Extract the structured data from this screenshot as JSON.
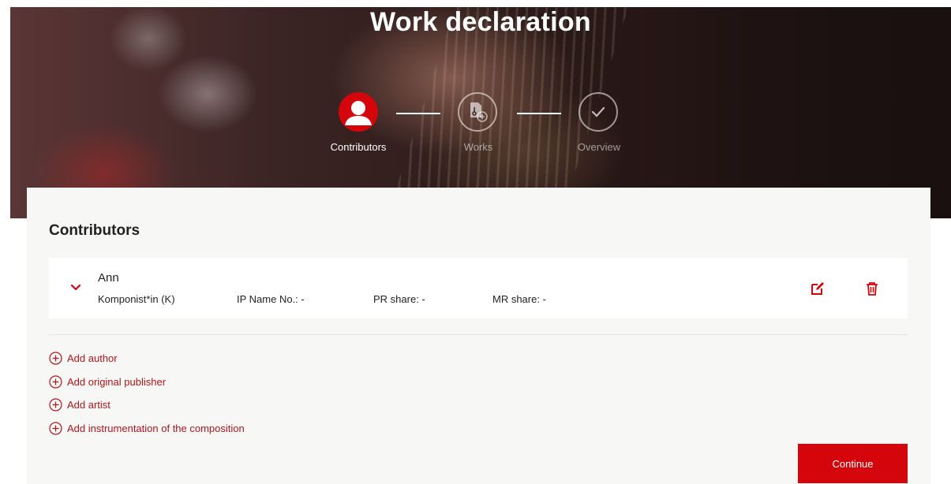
{
  "header": {
    "title": "Work declaration"
  },
  "stepper": {
    "steps": [
      {
        "label": "Contributors",
        "icon": "user-icon",
        "state": "active"
      },
      {
        "label": "Works",
        "icon": "document-add-icon",
        "state": "inactive"
      },
      {
        "label": "Overview",
        "icon": "checkmark-icon",
        "state": "inactive"
      }
    ]
  },
  "contributors": {
    "title": "Contributors",
    "items": [
      {
        "name": "Ann",
        "role": "Komponist*in (K)",
        "ip_name_no": "IP Name No.: -",
        "pr_share": "PR share: -",
        "mr_share": "MR share: -"
      }
    ]
  },
  "actions": {
    "add_author": "Add author",
    "add_original_publisher": "Add original publisher",
    "add_artist": "Add artist",
    "add_instrumentation": "Add instrumentation of the composition",
    "continue": "Continue"
  },
  "colors": {
    "accent": "#d4060b",
    "link": "#b3141a",
    "panel_bg": "#f7f7f6"
  }
}
